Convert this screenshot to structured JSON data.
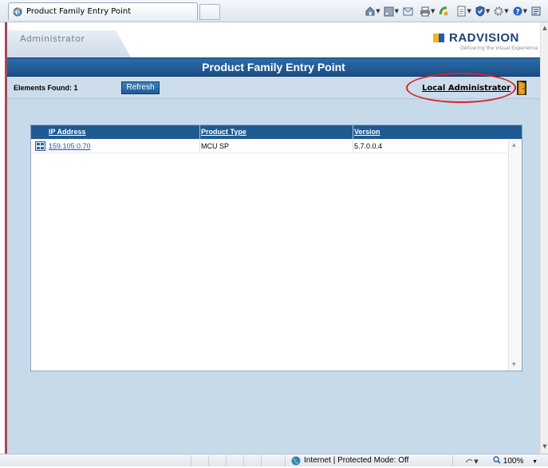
{
  "browser": {
    "tab_title": "Product Family Entry Point",
    "icons": [
      "home-icon",
      "feeds-icon",
      "mail-icon",
      "print-icon",
      "safety-icon",
      "page-icon",
      "security-icon",
      "tools-icon",
      "help-icon",
      "research-icon"
    ]
  },
  "header": {
    "admin_tab_label": "Administrator",
    "logo_text": "RADVISION",
    "logo_tagline": "Delivering the Visual Experience",
    "page_title": "Product Family Entry Point"
  },
  "toolbar": {
    "elements_found": "Elements Found: 1",
    "refresh_label": "Refresh",
    "user_link": "Local Administrator"
  },
  "grid": {
    "columns": [
      "IP Address",
      "Product Type",
      "Version"
    ],
    "rows": [
      {
        "ip": "159.105.0.70",
        "product_type": "MCU SP",
        "version": "5.7.0.0.4"
      }
    ]
  },
  "status": {
    "zone": "Internet | Protected Mode: Off",
    "zoom": "100%"
  },
  "colors": {
    "title_bar": "#1f5a92",
    "page_bg": "#c7daea",
    "annotation": "#d3252c"
  }
}
